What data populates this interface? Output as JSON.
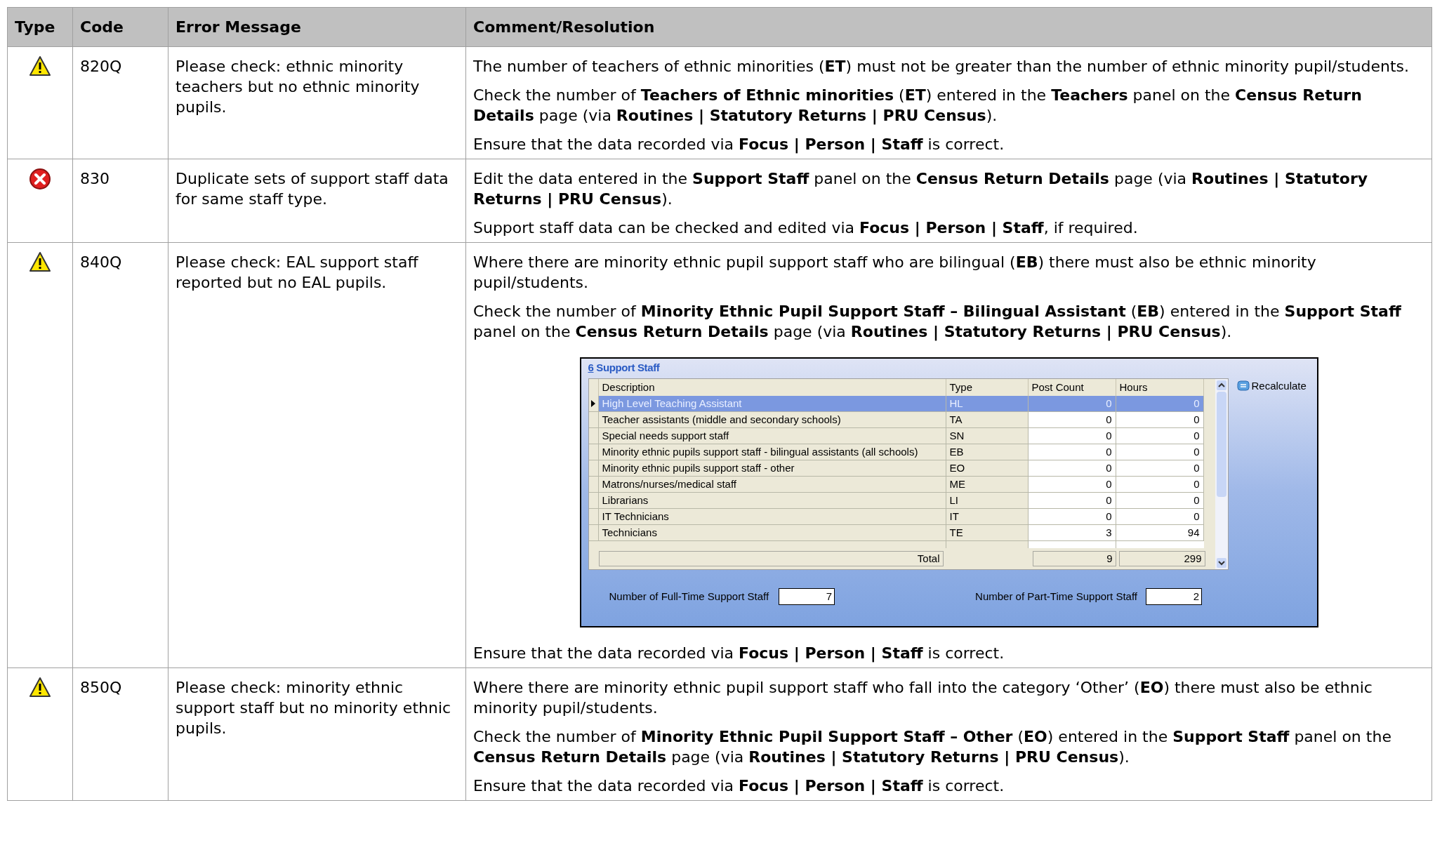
{
  "table": {
    "columns": [
      "Type",
      "Code",
      "Error Message",
      "Comment/Resolution"
    ],
    "rows": [
      {
        "kind": "warning",
        "code": "820Q",
        "message": "Please check: ethnic minority teachers but no ethnic minority pupils.",
        "comment": [
          {
            "kind": "paragraph",
            "text": "The number of teachers of ethnic minorities (**ET**) must not be greater than the number of ethnic minority pupil/students."
          },
          {
            "kind": "paragraph",
            "text": "Check the number of **Teachers of Ethnic minorities** (**ET**) entered in the **Teachers** panel on the **Census Return Details** page (via **Routines | Statutory Returns | PRU Census**)."
          },
          {
            "kind": "paragraph",
            "text": "Ensure that the data recorded via **Focus | Person | Staff** is correct."
          }
        ]
      },
      {
        "kind": "error",
        "code": "830",
        "message": "Duplicate sets of support staff data for same staff type.",
        "comment": [
          {
            "kind": "paragraph",
            "text": "Edit the data entered in the **Support Staff** panel on the **Census Return Details** page (via **Routines | Statutory Returns | PRU Census**)."
          },
          {
            "kind": "paragraph",
            "text": "Support staff data can be checked and edited via **Focus | Person | Staff**, if required."
          }
        ]
      },
      {
        "kind": "warning",
        "code": "840Q",
        "message": "Please check: EAL support staff reported but no EAL pupils.",
        "comment": [
          {
            "kind": "paragraph",
            "text": "Where there are minority ethnic pupil support staff who are bilingual (**EB**) there must also be ethnic minority pupil/students."
          },
          {
            "kind": "paragraph",
            "text": "Check the number of **Minority Ethnic Pupil Support Staff – Bilingual Assistant** (**EB**) entered in the **Support Staff** panel on the **Census Return Details** page (via **Routines | Statutory Returns | PRU Census**)."
          },
          {
            "kind": "screenshot",
            "number": "6",
            "title": "Support Staff",
            "columns": [
              "Description",
              "Type",
              "Post Count",
              "Hours"
            ],
            "rows": [
              {
                "description": "High Level Teaching Assistant",
                "type": "HL",
                "post_count": "0",
                "hours": "0",
                "selected": true
              },
              {
                "description": "Teacher assistants (middle and secondary schools)",
                "type": "TA",
                "post_count": "0",
                "hours": "0",
                "selected": false
              },
              {
                "description": "Special needs support staff",
                "type": "SN",
                "post_count": "0",
                "hours": "0",
                "selected": false
              },
              {
                "description": "Minority ethnic pupils support staff - bilingual assistants (all schools)",
                "type": "EB",
                "post_count": "0",
                "hours": "0",
                "selected": false
              },
              {
                "description": "Minority ethnic pupils support staff - other",
                "type": "EO",
                "post_count": "0",
                "hours": "0",
                "selected": false
              },
              {
                "description": "Matrons/nurses/medical staff",
                "type": "ME",
                "post_count": "0",
                "hours": "0",
                "selected": false
              },
              {
                "description": "Librarians",
                "type": "LI",
                "post_count": "0",
                "hours": "0",
                "selected": false
              },
              {
                "description": "IT Technicians",
                "type": "IT",
                "post_count": "0",
                "hours": "0",
                "selected": false
              },
              {
                "description": "Technicians",
                "type": "TE",
                "post_count": "3",
                "hours": "94",
                "selected": false
              }
            ],
            "total_label": "Total",
            "total_post_count": "9",
            "total_hours": "299",
            "recalculate": "Recalculate",
            "full_time_label": "Number of Full-Time Support Staff",
            "full_time_value": "7",
            "part_time_label": "Number of Part-Time Support Staff",
            "part_time_value": "2"
          },
          {
            "kind": "paragraph",
            "text": "Ensure that the data recorded via **Focus | Person | Staff** is correct."
          }
        ]
      },
      {
        "kind": "warning",
        "code": "850Q",
        "message": "Please check: minority ethnic support staff but no minority ethnic pupils.",
        "comment": [
          {
            "kind": "paragraph",
            "text": "Where there are minority ethnic pupil support staff who fall into the category ‘Other’ (**EO**) there must also be ethnic minority pupil/students."
          },
          {
            "kind": "paragraph",
            "text": "Check the number of **Minority Ethnic Pupil Support Staff – Other** (**EO**) entered in the **Support Staff** panel on the **Census Return Details** page (via **Routines | Statutory Returns | PRU Census**)."
          },
          {
            "kind": "paragraph",
            "text": "Ensure that the data recorded via **Focus | Person | Staff** is correct."
          }
        ]
      }
    ]
  }
}
